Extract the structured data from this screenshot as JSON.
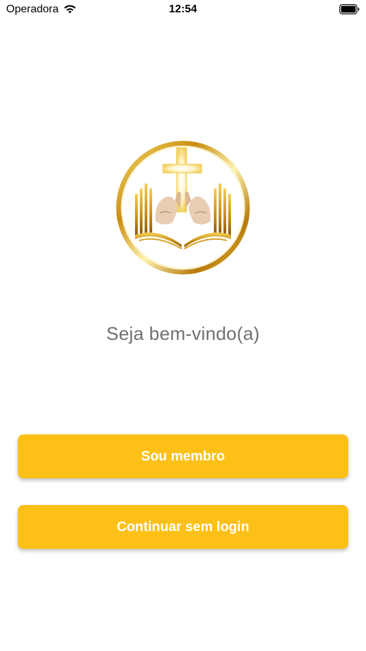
{
  "status_bar": {
    "carrier": "Operadora",
    "time": "12:54",
    "wifi_icon": "wifi-icon",
    "battery_icon": "battery-icon"
  },
  "logo": {
    "icon": "cross-bible-hands-logo",
    "colors": {
      "gold": "#d4a017",
      "gold_light": "#f5d76e",
      "gold_dark": "#a8720c"
    }
  },
  "welcome": {
    "text": "Seja bem-vindo(a)"
  },
  "buttons": {
    "member_label": "Sou membro",
    "guest_label": "Continuar sem login"
  },
  "colors": {
    "accent": "#fcc017",
    "button_text": "#ffffff",
    "welcome_text": "#707070"
  }
}
